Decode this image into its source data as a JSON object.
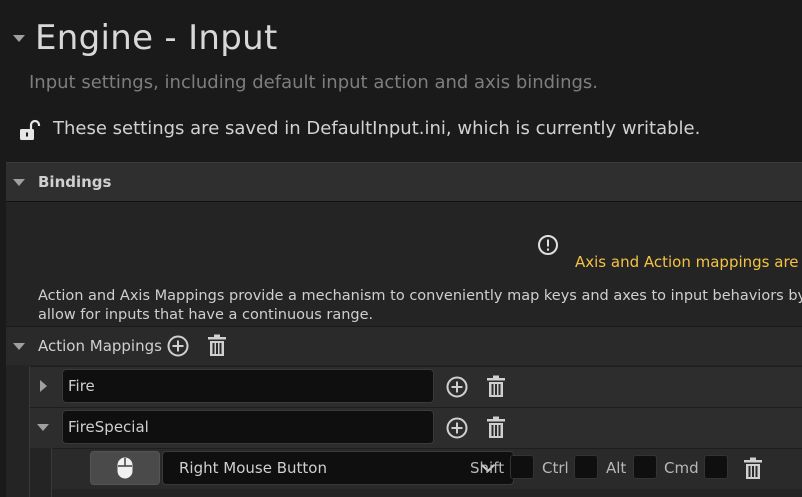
{
  "header": {
    "title": "Engine - Input",
    "subtitle": "Input settings, including default input action and axis bindings.",
    "save_info": "These settings are saved in DefaultInput.ini, which is currently writable."
  },
  "bindings": {
    "label": "Bindings",
    "warning": "Axis and Action mappings are no",
    "info_line1": "Action and Axis Mappings provide a mechanism to conveniently map keys and axes to input behaviors by in",
    "info_line2": "allow for inputs that have a continuous range."
  },
  "action_mappings": {
    "label": "Action Mappings",
    "items": [
      {
        "name": "Fire",
        "expanded": false
      },
      {
        "name": "FireSpecial",
        "expanded": true
      }
    ],
    "key_binding": {
      "key": "Right Mouse Button",
      "modifiers": [
        "Shift",
        "Ctrl",
        "Alt",
        "Cmd"
      ]
    }
  },
  "colors": {
    "warning": "#f5c242",
    "background": "#1a1a1a",
    "panel": "#2f2f2f"
  },
  "icons": [
    "collapse-triangle-icon",
    "unlock-icon",
    "warning-circle-icon",
    "add-circle-icon",
    "trash-icon",
    "mouse-icon",
    "chevron-down-icon"
  ]
}
